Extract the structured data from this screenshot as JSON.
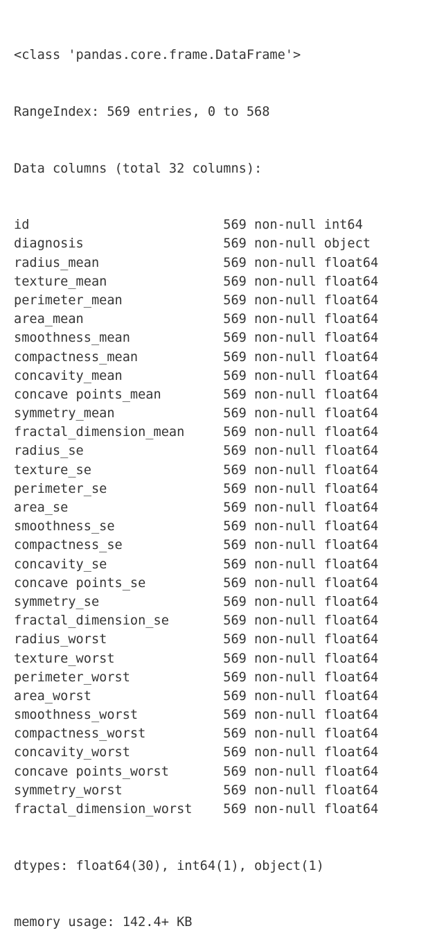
{
  "output": {
    "class_line": "<class 'pandas.core.frame.DataFrame'>",
    "index_line": "RangeIndex: 569 entries, 0 to 568",
    "columns_header": "Data columns (total 32 columns):",
    "dtypes_line": "dtypes: float64(30), int64(1), object(1)",
    "memory_line": "memory usage: 142.4+ KB",
    "name_field_width": 27,
    "non_null_label": "non-null",
    "entries": 569,
    "total_columns": 32,
    "range_start": 0,
    "range_end": 568,
    "memory_usage": "142.4+ KB",
    "dtype_counts": {
      "float64": 30,
      "int64": 1,
      "object": 1
    },
    "text_color": "#353535",
    "background_color": "#ffffff",
    "columns": [
      {
        "name": "id",
        "count": "569",
        "null_label": "non-null",
        "dtype": "int64"
      },
      {
        "name": "diagnosis",
        "count": "569",
        "null_label": "non-null",
        "dtype": "object"
      },
      {
        "name": "radius_mean",
        "count": "569",
        "null_label": "non-null",
        "dtype": "float64"
      },
      {
        "name": "texture_mean",
        "count": "569",
        "null_label": "non-null",
        "dtype": "float64"
      },
      {
        "name": "perimeter_mean",
        "count": "569",
        "null_label": "non-null",
        "dtype": "float64"
      },
      {
        "name": "area_mean",
        "count": "569",
        "null_label": "non-null",
        "dtype": "float64"
      },
      {
        "name": "smoothness_mean",
        "count": "569",
        "null_label": "non-null",
        "dtype": "float64"
      },
      {
        "name": "compactness_mean",
        "count": "569",
        "null_label": "non-null",
        "dtype": "float64"
      },
      {
        "name": "concavity_mean",
        "count": "569",
        "null_label": "non-null",
        "dtype": "float64"
      },
      {
        "name": "concave points_mean",
        "count": "569",
        "null_label": "non-null",
        "dtype": "float64"
      },
      {
        "name": "symmetry_mean",
        "count": "569",
        "null_label": "non-null",
        "dtype": "float64"
      },
      {
        "name": "fractal_dimension_mean",
        "count": "569",
        "null_label": "non-null",
        "dtype": "float64"
      },
      {
        "name": "radius_se",
        "count": "569",
        "null_label": "non-null",
        "dtype": "float64"
      },
      {
        "name": "texture_se",
        "count": "569",
        "null_label": "non-null",
        "dtype": "float64"
      },
      {
        "name": "perimeter_se",
        "count": "569",
        "null_label": "non-null",
        "dtype": "float64"
      },
      {
        "name": "area_se",
        "count": "569",
        "null_label": "non-null",
        "dtype": "float64"
      },
      {
        "name": "smoothness_se",
        "count": "569",
        "null_label": "non-null",
        "dtype": "float64"
      },
      {
        "name": "compactness_se",
        "count": "569",
        "null_label": "non-null",
        "dtype": "float64"
      },
      {
        "name": "concavity_se",
        "count": "569",
        "null_label": "non-null",
        "dtype": "float64"
      },
      {
        "name": "concave points_se",
        "count": "569",
        "null_label": "non-null",
        "dtype": "float64"
      },
      {
        "name": "symmetry_se",
        "count": "569",
        "null_label": "non-null",
        "dtype": "float64"
      },
      {
        "name": "fractal_dimension_se",
        "count": "569",
        "null_label": "non-null",
        "dtype": "float64"
      },
      {
        "name": "radius_worst",
        "count": "569",
        "null_label": "non-null",
        "dtype": "float64"
      },
      {
        "name": "texture_worst",
        "count": "569",
        "null_label": "non-null",
        "dtype": "float64"
      },
      {
        "name": "perimeter_worst",
        "count": "569",
        "null_label": "non-null",
        "dtype": "float64"
      },
      {
        "name": "area_worst",
        "count": "569",
        "null_label": "non-null",
        "dtype": "float64"
      },
      {
        "name": "smoothness_worst",
        "count": "569",
        "null_label": "non-null",
        "dtype": "float64"
      },
      {
        "name": "compactness_worst",
        "count": "569",
        "null_label": "non-null",
        "dtype": "float64"
      },
      {
        "name": "concavity_worst",
        "count": "569",
        "null_label": "non-null",
        "dtype": "float64"
      },
      {
        "name": "concave points_worst",
        "count": "569",
        "null_label": "non-null",
        "dtype": "float64"
      },
      {
        "name": "symmetry_worst",
        "count": "569",
        "null_label": "non-null",
        "dtype": "float64"
      },
      {
        "name": "fractal_dimension_worst",
        "count": "569",
        "null_label": "non-null",
        "dtype": "float64"
      }
    ]
  }
}
